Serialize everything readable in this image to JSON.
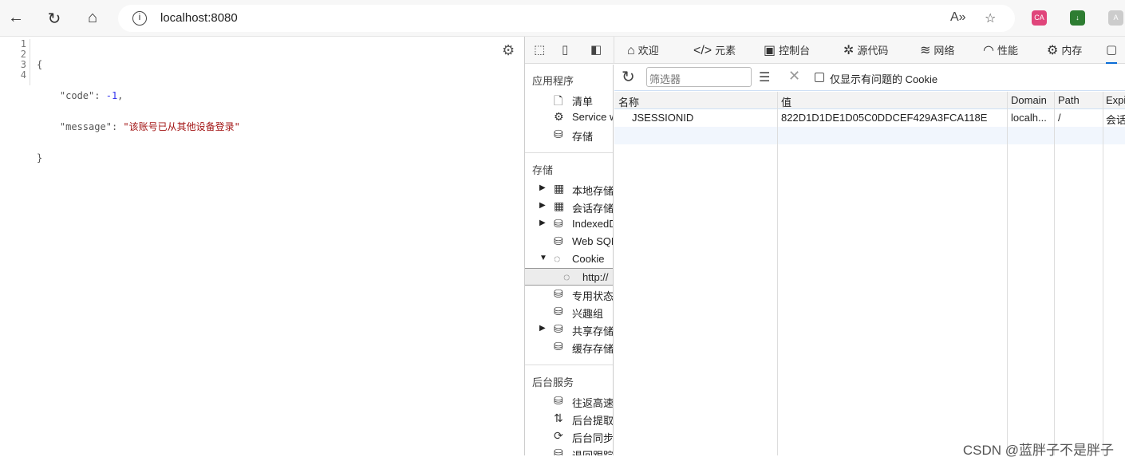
{
  "browser": {
    "url": "localhost:8080",
    "ext_label": "CA"
  },
  "code": {
    "line_numbers": [
      "1",
      "2",
      "3",
      "4"
    ],
    "open": "{",
    "code_key": "\"code\"",
    "code_value": "-1",
    "message_key": "\"message\"",
    "message_value": "\"该账号已从其他设备登录\"",
    "close": "}"
  },
  "devtools": {
    "tabs": [
      {
        "icon": "⌂",
        "label": "欢迎"
      },
      {
        "icon": "</>",
        "label": "元素"
      },
      {
        "icon": "▣",
        "label": "控制台"
      },
      {
        "icon": "✲",
        "label": "源代码"
      },
      {
        "icon": "≋",
        "label": "网络"
      },
      {
        "icon": "◠",
        "label": "性能"
      },
      {
        "icon": "⚙",
        "label": "内存"
      }
    ],
    "sidebar": {
      "section_app": "应用程序",
      "app_items": [
        "清单",
        "Service w",
        "存储"
      ],
      "section_storage": "存储",
      "storage_items": [
        "本地存储",
        "会话存储",
        "IndexedD",
        "Web SQL",
        "Cookie",
        "http://",
        "专用状态",
        "兴趣组",
        "共享存储",
        "缓存存储"
      ],
      "section_bg": "后台服务",
      "bg_items": [
        "往返高速",
        "后台提取",
        "后台同步",
        "退回跟踪"
      ]
    },
    "filter": {
      "placeholder": "筛选器",
      "checkbox_label": "仅显示有问题的 Cookie",
      "checked": false
    },
    "table": {
      "headers": [
        "名称",
        "值",
        "Domain",
        "Path",
        "Expi"
      ],
      "rows": [
        [
          "JSESSIONID",
          "822D1D1DE1D05C0DDCEF429A3FCA118E",
          "localh...",
          "/",
          "会话"
        ]
      ]
    }
  },
  "watermark": "CSDN @蓝胖子不是胖子"
}
